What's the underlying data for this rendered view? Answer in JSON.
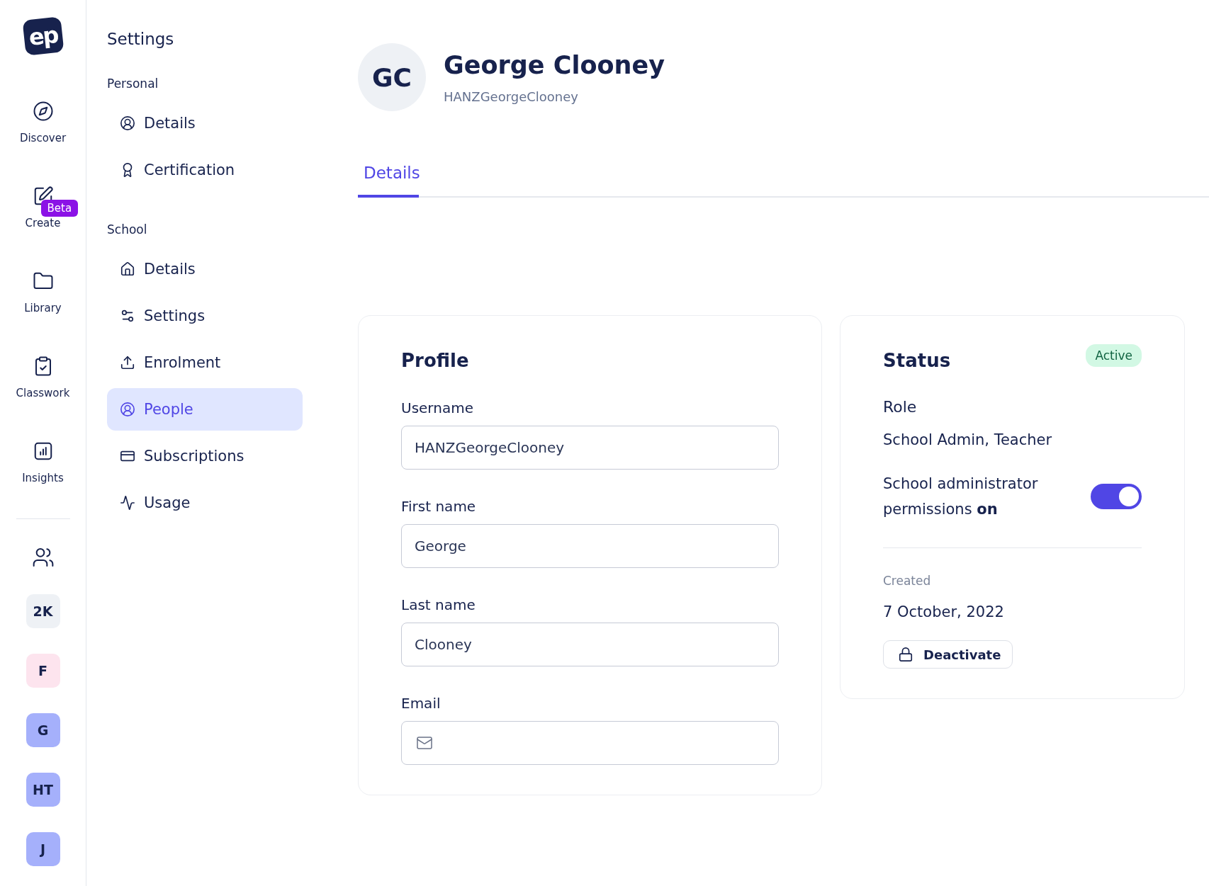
{
  "rail": {
    "logo": "ep",
    "items": [
      {
        "label": "Discover"
      },
      {
        "label": "Create",
        "badge": "Beta"
      },
      {
        "label": "Library"
      },
      {
        "label": "Classwork"
      },
      {
        "label": "Insights"
      }
    ],
    "workspaces": [
      {
        "initials": "2K",
        "color": "#eef1f5"
      },
      {
        "initials": "F",
        "color": "#fde4ee"
      },
      {
        "initials": "G",
        "color": "#a5b0fb"
      },
      {
        "initials": "HT",
        "color": "#a5b0fb"
      },
      {
        "initials": "J",
        "color": "#a5b0fb"
      }
    ]
  },
  "settings_nav": {
    "title": "Settings",
    "sections": [
      {
        "label": "Personal",
        "items": [
          {
            "label": "Details",
            "selected": false
          },
          {
            "label": "Certification",
            "selected": false
          }
        ]
      },
      {
        "label": "School",
        "items": [
          {
            "label": "Details",
            "selected": false
          },
          {
            "label": "Settings",
            "selected": false
          },
          {
            "label": "Enrolment",
            "selected": false
          },
          {
            "label": "People",
            "selected": true
          },
          {
            "label": "Subscriptions",
            "selected": false
          },
          {
            "label": "Usage",
            "selected": false
          }
        ]
      }
    ]
  },
  "user": {
    "initials": "GC",
    "name": "George Clooney",
    "username": "HANZGeorgeClooney"
  },
  "tabs": [
    {
      "label": "Details",
      "selected": true
    }
  ],
  "profile": {
    "title": "Profile",
    "fields": [
      {
        "label": "Username",
        "value": "HANZGeorgeClooney",
        "kind": "text"
      },
      {
        "label": "First name",
        "value": "George",
        "kind": "text"
      },
      {
        "label": "Last name",
        "value": "Clooney",
        "kind": "text"
      },
      {
        "label": "Email",
        "kind": "email"
      }
    ]
  },
  "status": {
    "title": "Status",
    "badge": "Active",
    "role_label": "Role",
    "role": "School Admin, Teacher",
    "permissions": "School administrator permissions **on**",
    "permissions_on": true,
    "created_label": "Created",
    "created": "7 October, 2022",
    "button": "Deactivate"
  }
}
